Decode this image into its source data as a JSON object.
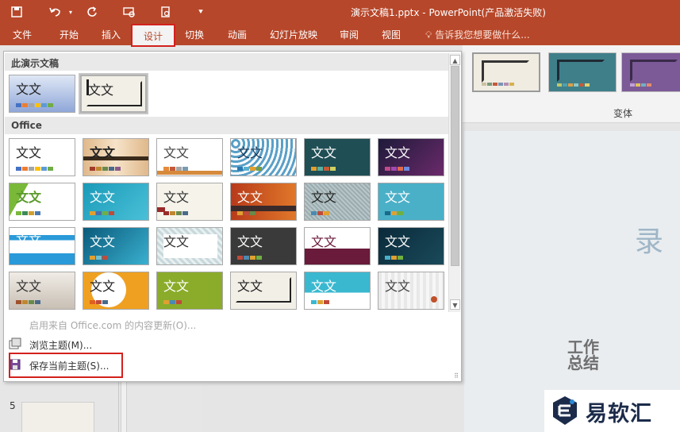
{
  "window": {
    "title": "演示文稿1.pptx - PowerPoint(产品激活失败)"
  },
  "ribbon_tabs": [
    {
      "label": "文件",
      "active": false
    },
    {
      "label": "开始",
      "active": false
    },
    {
      "label": "插入",
      "active": false
    },
    {
      "label": "设计",
      "active": true
    },
    {
      "label": "切换",
      "active": false
    },
    {
      "label": "动画",
      "active": false
    },
    {
      "label": "幻灯片放映",
      "active": false
    },
    {
      "label": "审阅",
      "active": false
    },
    {
      "label": "视图",
      "active": false
    }
  ],
  "tell_me": {
    "placeholder": "告诉我您想要做什么..."
  },
  "ribbon_groups": {
    "variants_label": "变体"
  },
  "theme_panel": {
    "section_this": "此演示文稿",
    "section_office": "Office",
    "theme_sample_text": "文文",
    "menu": {
      "enable_updates": "启用来自 Office.com 的内容更新(O)...",
      "browse": "浏览主题(M)...",
      "save": "保存当前主题(S)..."
    }
  },
  "slide_panel": {
    "slide_number": "5"
  },
  "slide_canvas": {
    "decor_char": "录",
    "decor_text": "工作总结"
  },
  "watermark": {
    "brand": "易软汇"
  },
  "colors": {
    "accent": "#b7472a",
    "highlight_box": "#d3211d"
  }
}
